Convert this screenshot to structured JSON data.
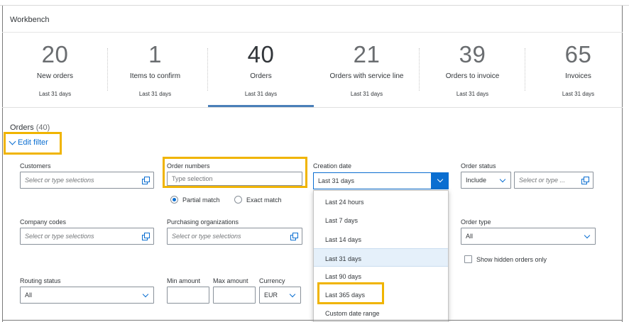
{
  "header": {
    "title": "Workbench"
  },
  "tiles": [
    {
      "count": "20",
      "label": "New orders",
      "period": "Last 31 days"
    },
    {
      "count": "1",
      "label": "Items to confirm",
      "period": "Last 31 days"
    },
    {
      "count": "40",
      "label": "Orders",
      "period": "Last 31 days"
    },
    {
      "count": "21",
      "label": "Orders with service line",
      "period": "Last 31 days"
    },
    {
      "count": "39",
      "label": "Orders to invoice",
      "period": "Last 31 days"
    },
    {
      "count": "65",
      "label": "Invoices",
      "period": "Last 31 days"
    }
  ],
  "active_tile": "Orders",
  "orders": {
    "title": "Orders",
    "count": "(40)"
  },
  "edit_filter": {
    "label": "Edit filter"
  },
  "filters": {
    "customers": {
      "label": "Customers",
      "placeholder": "Select or type selections"
    },
    "order_numbers": {
      "label": "Order numbers",
      "placeholder": "Type selection"
    },
    "match": {
      "partial": "Partial match",
      "exact": "Exact match",
      "selected": "Partial match"
    },
    "creation_date": {
      "label": "Creation date",
      "value": "Last 31 days"
    },
    "order_status": {
      "label": "Order status",
      "mode": "Include",
      "placeholder": "Select or type ..."
    },
    "company_codes": {
      "label": "Company codes",
      "placeholder": "Select or type selections"
    },
    "purchasing_orgs": {
      "label": "Purchasing organizations",
      "placeholder": "Select or type selections"
    },
    "order_type": {
      "label": "Order type",
      "value": "All"
    },
    "hidden_orders": {
      "label": "Show hidden orders only"
    },
    "routing_status": {
      "label": "Routing status",
      "value": "All"
    },
    "min_amount": {
      "label": "Min amount"
    },
    "max_amount": {
      "label": "Max amount"
    },
    "currency": {
      "label": "Currency",
      "value": "EUR"
    }
  },
  "date_options": [
    "Last 24 hours",
    "Last 7 days",
    "Last 14 days",
    "Last 31 days",
    "Last 90 days",
    "Last 365 days",
    "Custom date range"
  ],
  "colors": {
    "accent": "#0a6ed1",
    "highlight": "#f0b400",
    "tile_bar": "#4a7fb8"
  }
}
